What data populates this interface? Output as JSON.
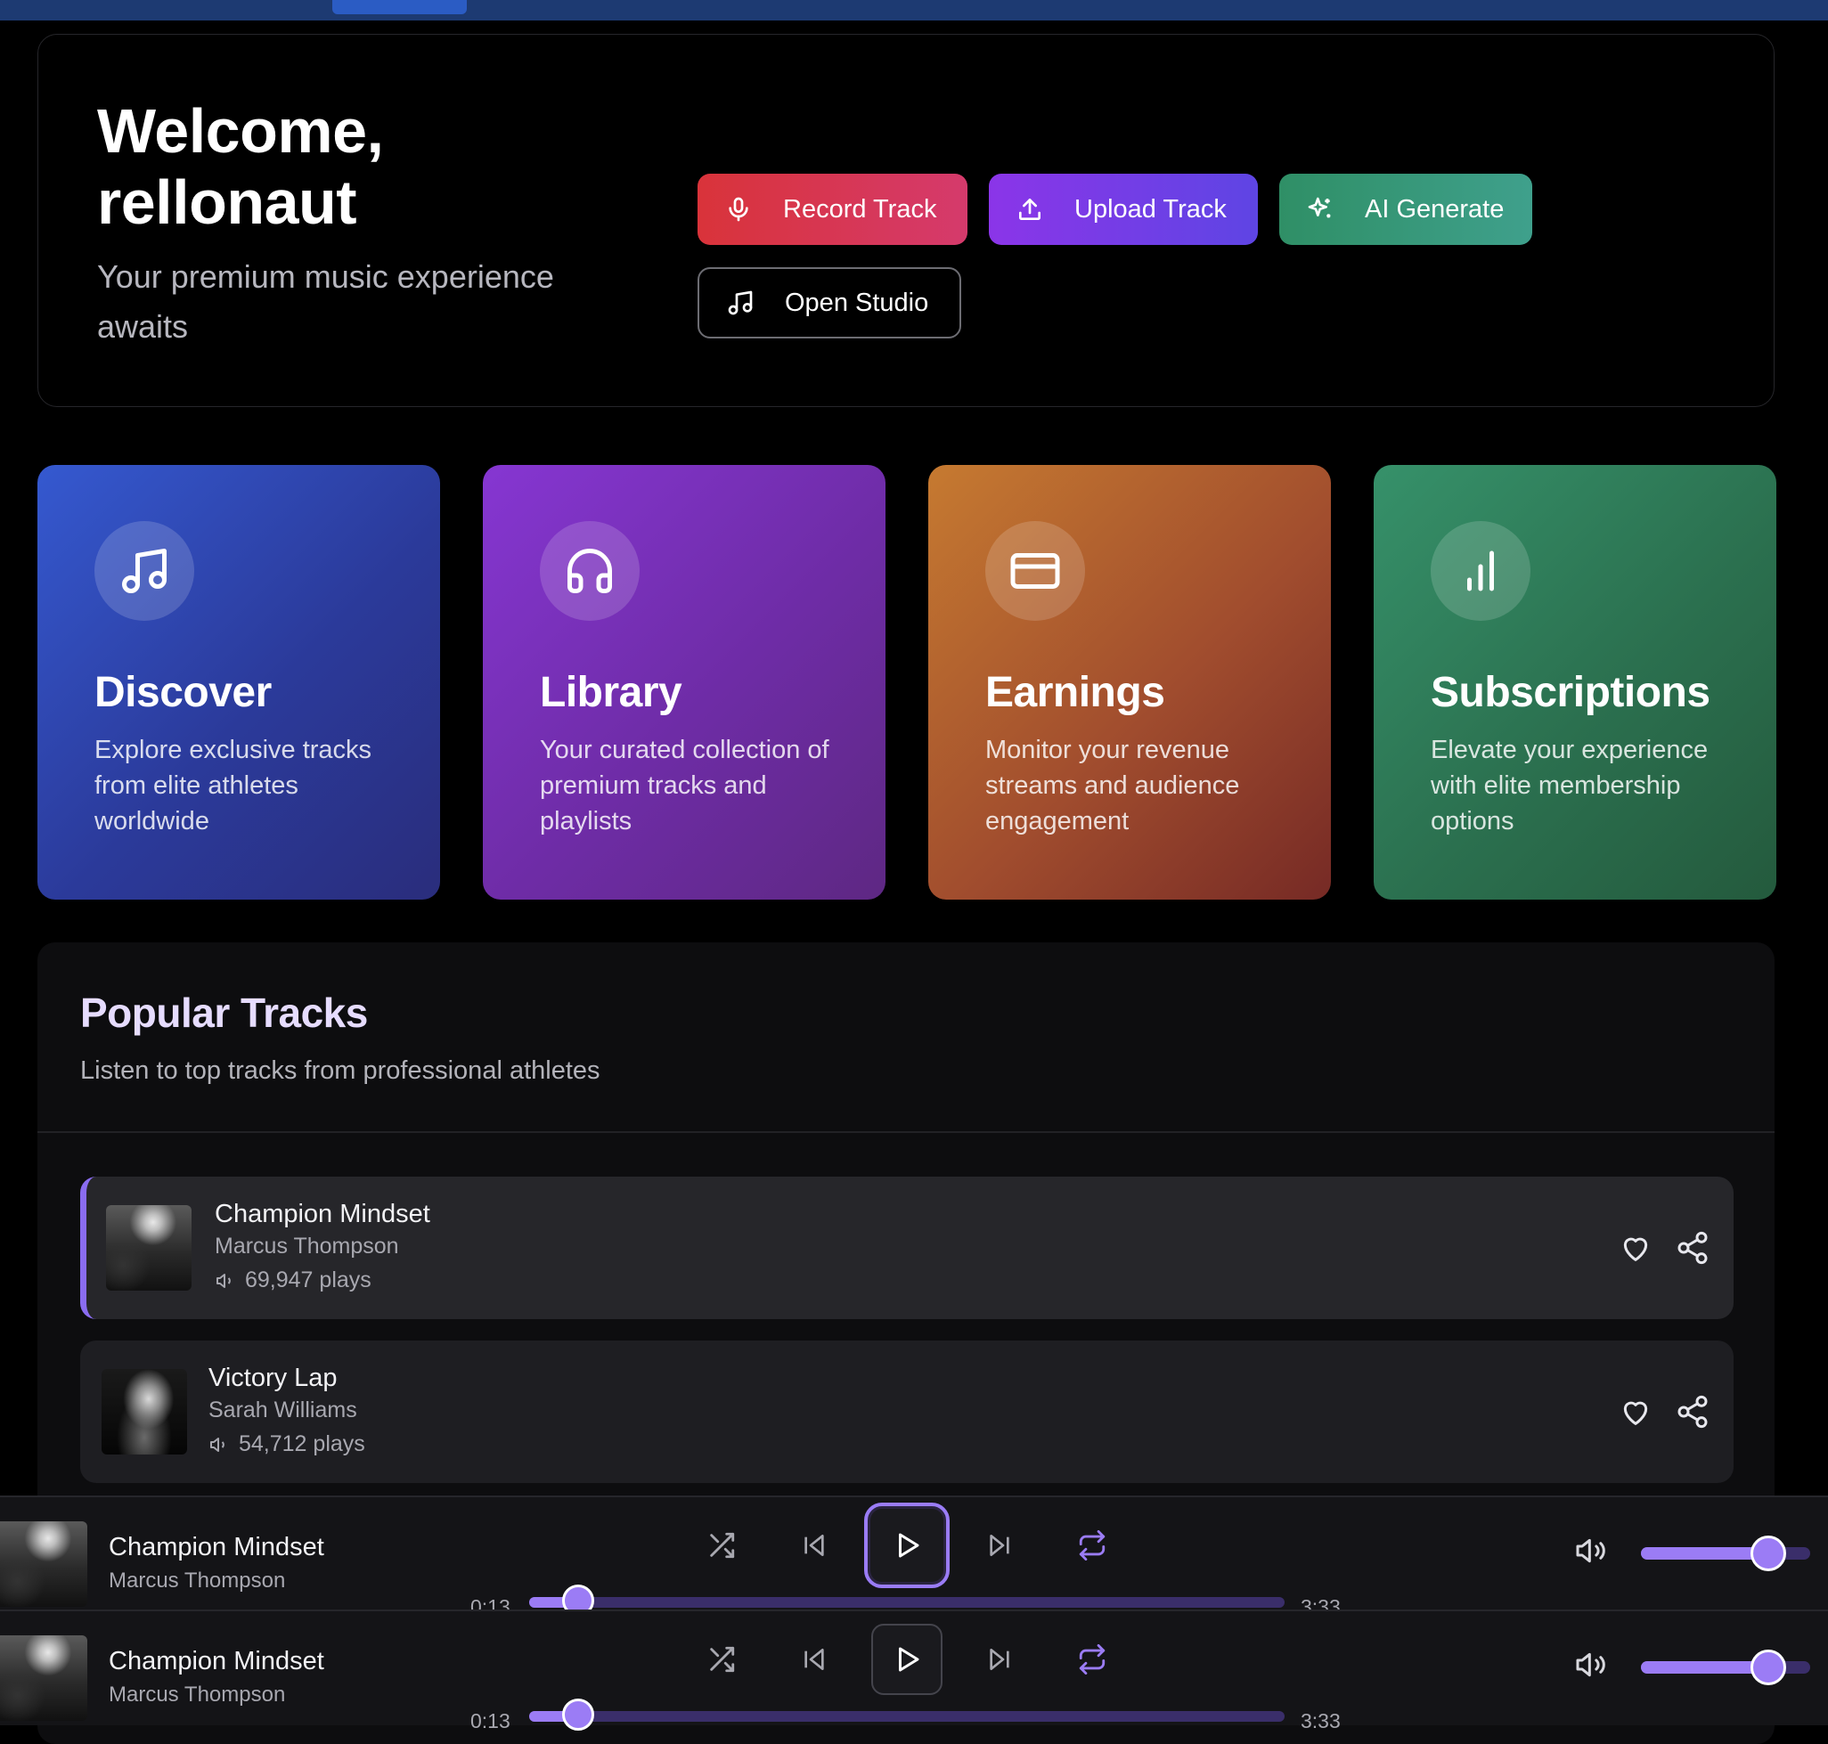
{
  "welcome": {
    "title": "Welcome, rellonaut",
    "subtitle": "Your premium music experience awaits",
    "buttons": {
      "record": "Record Track",
      "upload": "Upload Track",
      "ai": "AI Generate",
      "studio": "Open Studio"
    }
  },
  "cards": [
    {
      "title": "Discover",
      "desc": "Explore exclusive tracks from elite athletes worldwide",
      "icon": "music-note-icon"
    },
    {
      "title": "Library",
      "desc": "Your curated collection of premium tracks and playlists",
      "icon": "headphones-icon"
    },
    {
      "title": "Earnings",
      "desc": "Monitor your revenue streams and audience engagement",
      "icon": "credit-card-icon"
    },
    {
      "title": "Subscriptions",
      "desc": "Elevate your experience with elite membership options",
      "icon": "bar-chart-icon"
    }
  ],
  "popular": {
    "title": "Popular Tracks",
    "subtitle": "Listen to top tracks from professional athletes",
    "tracks": [
      {
        "title": "Champion Mindset",
        "artist": "Marcus Thompson",
        "plays": "69,947 plays",
        "active": true
      },
      {
        "title": "Victory Lap",
        "artist": "Sarah Williams",
        "plays": "54,712 plays",
        "active": false
      }
    ]
  },
  "players": [
    {
      "title": "Champion Mindset",
      "artist": "Marcus Thompson",
      "current_time": "0:13",
      "duration": "3:33",
      "progress": 0.065,
      "volume": 0.75
    },
    {
      "title": "Champion Mindset",
      "artist": "Marcus Thompson",
      "current_time": "0:13",
      "duration": "3:33",
      "progress": 0.065,
      "volume": 0.75
    }
  ],
  "colors": {
    "accent": "#9b7cf5",
    "record": "#d9333a",
    "upload": "#7b3de8",
    "ai_generate": "#3a9a7a"
  }
}
